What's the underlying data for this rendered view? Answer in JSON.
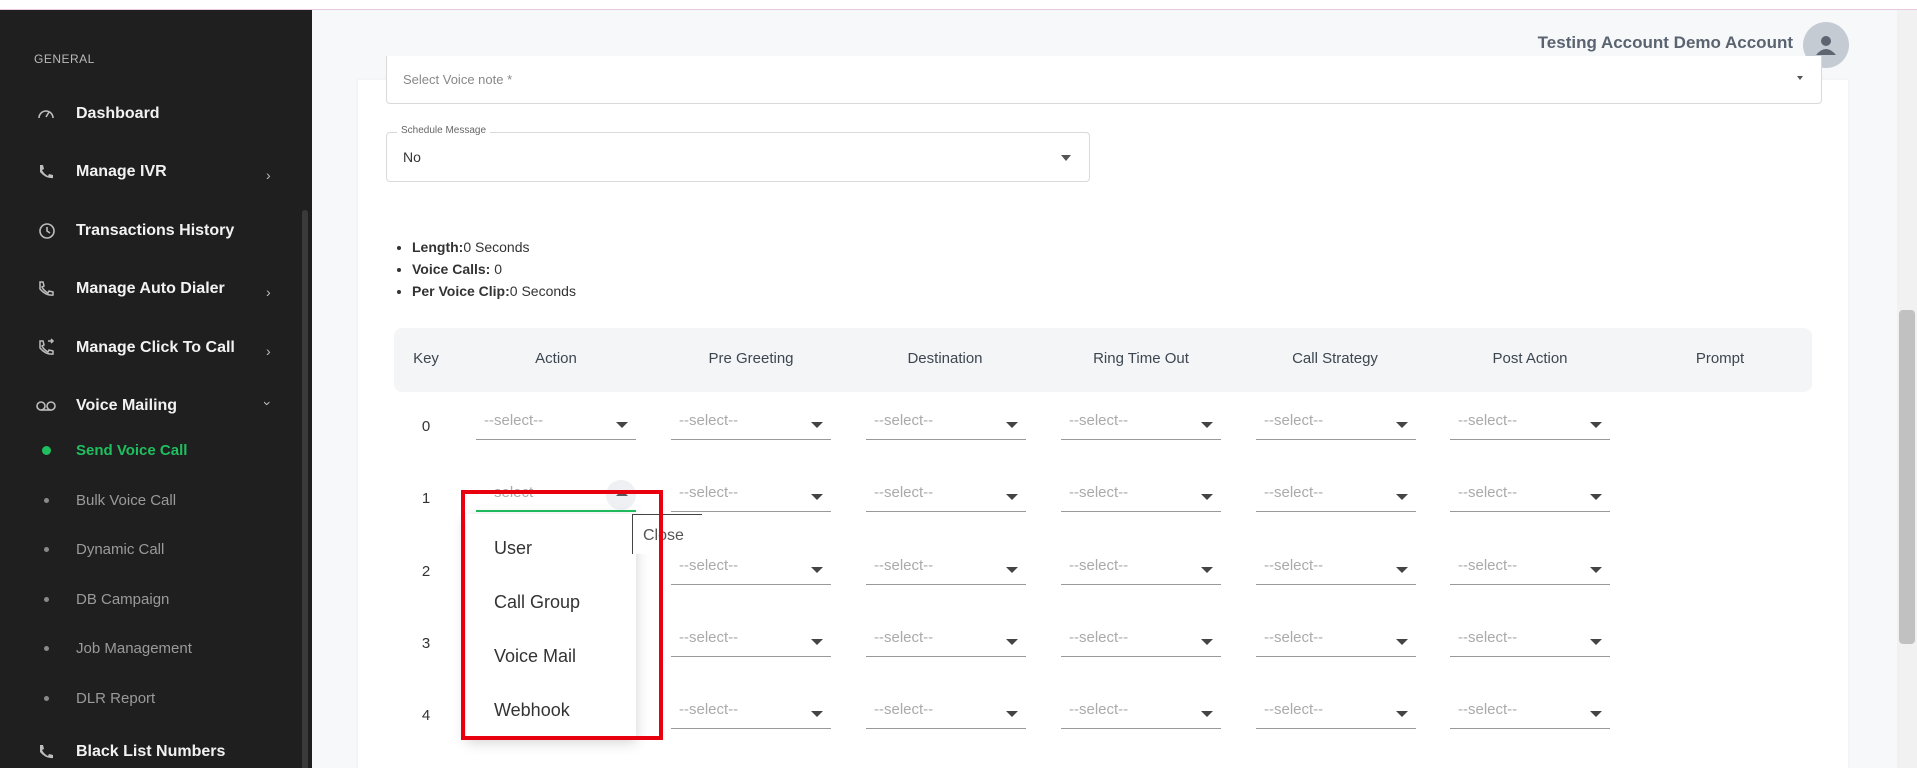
{
  "sidebar": {
    "section_label": "GENERAL",
    "items": [
      {
        "label": "Dashboard",
        "icon": "gauge-icon"
      },
      {
        "label": "Manage IVR",
        "icon": "phone-icon"
      },
      {
        "label": "Transactions History",
        "icon": "history-icon"
      },
      {
        "label": "Manage Auto Dialer",
        "icon": "phone-auto-icon"
      },
      {
        "label": "Manage Click To Call",
        "icon": "phone-forward-icon"
      },
      {
        "label": "Voice Mailing",
        "icon": "voicemail-icon"
      }
    ],
    "subitems": [
      {
        "label": "Send Voice Call",
        "active": true
      },
      {
        "label": "Bulk Voice Call"
      },
      {
        "label": "Dynamic Call"
      },
      {
        "label": "DB Campaign"
      },
      {
        "label": "Job Management"
      },
      {
        "label": "DLR Report"
      }
    ],
    "bottom_item": {
      "label": "Black List Numbers",
      "icon": "phone-icon"
    }
  },
  "header": {
    "account_name": "Testing Account Demo Account"
  },
  "form": {
    "voice_note_placeholder": "Select Voice note *",
    "schedule_legend": "Schedule Message",
    "schedule_value": "No"
  },
  "stats": {
    "length_label": "Length:",
    "length_value": "0 Seconds",
    "calls_label": "Voice Calls:",
    "calls_value": " 0",
    "clip_label": "Per Voice Clip:",
    "clip_value": "0 Seconds"
  },
  "table": {
    "headers": [
      "Key",
      "Action",
      "Pre Greeting",
      "Destination",
      "Ring Time Out",
      "Call Strategy",
      "Post Action",
      "Prompt"
    ],
    "placeholder": "--select--",
    "keys": [
      "0",
      "1",
      "2",
      "3",
      "4"
    ]
  },
  "dropdown": {
    "options": [
      "User",
      "Call Group",
      "Voice Mail",
      "Webhook"
    ],
    "close_label": "Close"
  },
  "colors": {
    "sidebar_bg": "#1f1f1f",
    "accent_green": "#1fbf5f",
    "highlight_red": "#e8000f"
  }
}
